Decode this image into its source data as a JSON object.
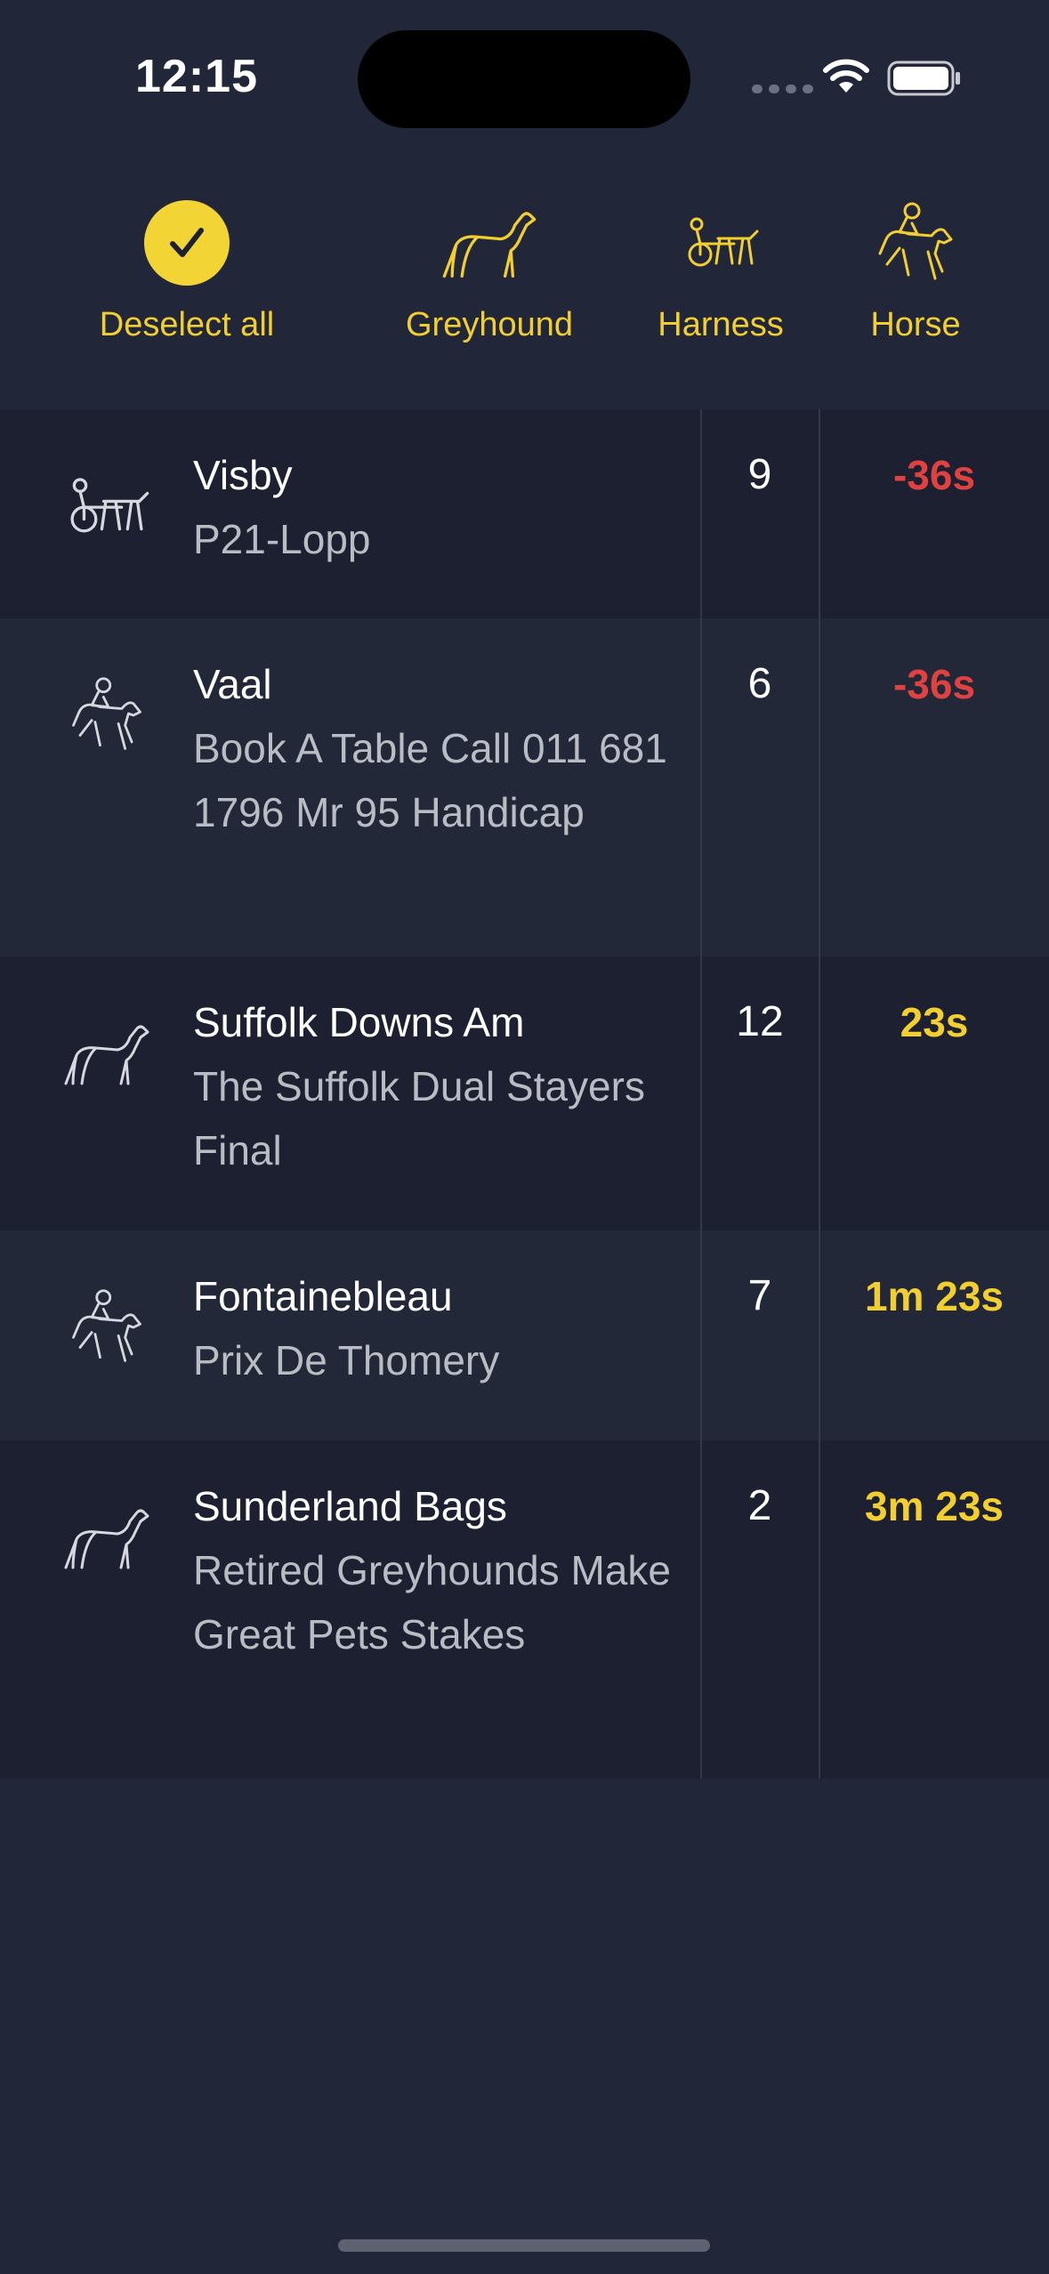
{
  "status_bar": {
    "time": "12:15"
  },
  "filters": [
    {
      "label": "Deselect all",
      "icon": "check-circle-icon",
      "selected": true
    },
    {
      "label": "Greyhound",
      "icon": "greyhound-icon"
    },
    {
      "label": "Harness",
      "icon": "harness-icon"
    },
    {
      "label": "Horse",
      "icon": "horse-jockey-icon"
    }
  ],
  "races": [
    {
      "type": "harness",
      "icon": "harness-icon",
      "venue": "Visby",
      "race": "P21-Lopp",
      "runners": "9",
      "countdown": "-36s",
      "countdown_color": "#e04141"
    },
    {
      "type": "horse",
      "icon": "horse-jockey-icon",
      "venue": "Vaal",
      "race": "Book A Table Call 011 681 1796 Mr 95 Handicap",
      "runners": "6",
      "countdown": "-36s",
      "countdown_color": "#e04141"
    },
    {
      "type": "greyhound",
      "icon": "greyhound-icon",
      "venue": "Suffolk Downs Am",
      "race": "The Suffolk Dual Stayers Final",
      "runners": "12",
      "countdown": "23s",
      "countdown_color": "#f2cf2e"
    },
    {
      "type": "horse",
      "icon": "horse-jockey-icon",
      "venue": "Fontainebleau",
      "race": "Prix De Thomery",
      "runners": "7",
      "countdown": "1m 23s",
      "countdown_color": "#f2cf2e"
    },
    {
      "type": "greyhound",
      "icon": "greyhound-icon",
      "venue": "Sunderland Bags",
      "race": "Retired Greyhounds Make Great Pets Stakes",
      "runners": "2",
      "countdown": "3m 23s",
      "countdown_color": "#f2cf2e"
    }
  ],
  "colors": {
    "background": "#212738",
    "accent": "#f2d535",
    "negative": "#e04141",
    "secondary_text": "#b9bcc3"
  }
}
